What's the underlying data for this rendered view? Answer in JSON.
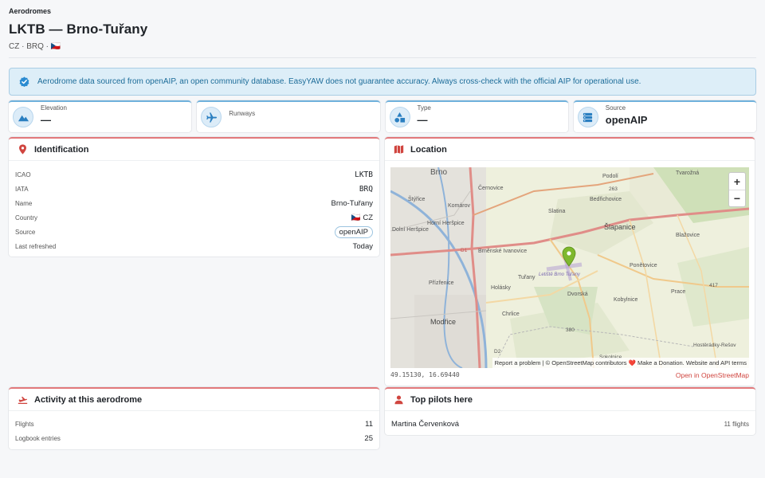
{
  "breadcrumb": "Aerodromes",
  "title": "LKTB — Brno-Tuřany",
  "subtitle": "CZ · BRQ · 🇨🇿",
  "notice": "Aerodrome data sourced from openAIP, an open community database. EasyYAW does not guarantee accuracy. Always cross-check with the official AIP for operational use.",
  "stats": [
    {
      "label": "Elevation",
      "value": "—",
      "icon": "mountain-icon"
    },
    {
      "label": "Runways",
      "value": "",
      "icon": "plane-icon"
    },
    {
      "label": "Type",
      "value": "—",
      "icon": "shapes-icon"
    },
    {
      "label": "Source",
      "value": "openAIP",
      "icon": "database-icon"
    }
  ],
  "identification": {
    "title": "Identification",
    "rows": {
      "icao": {
        "k": "ICAO",
        "v": "LKTB"
      },
      "iata": {
        "k": "IATA",
        "v": "BRQ"
      },
      "name": {
        "k": "Name",
        "v": "Brno-Tuřany"
      },
      "country": {
        "k": "Country",
        "v": "🇨🇿 CZ"
      },
      "source": {
        "k": "Source",
        "v": "openAIP"
      },
      "refreshed": {
        "k": "Last refreshed",
        "v": "Today"
      }
    }
  },
  "location": {
    "title": "Location",
    "coords": "49.15130, 16.69440",
    "open_link": "Open in OpenStreetMap",
    "zoom_in": "+",
    "zoom_out": "−",
    "attribution": "Report a problem | © OpenStreetMap contributors ❤️ Make a Donation. Website and API terms",
    "labels": {
      "brno": "Brno",
      "podoli": "Podolí",
      "tvarozna": "Tvarožná",
      "cernovice": "Černovice",
      "bedrichovice": "Bedřichovice",
      "styrice": "Štýřice",
      "komarov": "Komárov",
      "slatina": "Slatina",
      "slapanice": "Šlapanice",
      "horni": "Horní Heršpice",
      "dolni": "Dolní Heršpice",
      "blazovice": "Blažovice",
      "brnenske": "Brněnské Ivanovice",
      "ponetovice": "Ponětovice",
      "prizrenice": "Přízřenice",
      "holasky": "Holásky",
      "turany": "Tuřany",
      "prace": "Prace",
      "letiste": "Letiště Brno Tuřany",
      "dvorska": "Dvorská",
      "kobylnice": "Kobylnice",
      "chrlice": "Chrlice",
      "modrice": "Modřice",
      "hosteradky": "Hostěrádky-Rešov",
      "sokolnice": "Sokolnice",
      "r417": "417",
      "r380": "380",
      "d2": "D2",
      "r263": "263",
      "d1": "D1"
    }
  },
  "activity": {
    "title": "Activity at this aerodrome",
    "flights_label": "Flights",
    "flights": "11",
    "logbook_label": "Logbook entries",
    "logbook": "25"
  },
  "pilots": {
    "title": "Top pilots here",
    "items": [
      {
        "name": "Martina Červenková",
        "count": "11 flights"
      }
    ]
  },
  "colors": {
    "accent": "#d0453f",
    "info": "#1c6c99",
    "stat_border": "#6fb1dc"
  }
}
